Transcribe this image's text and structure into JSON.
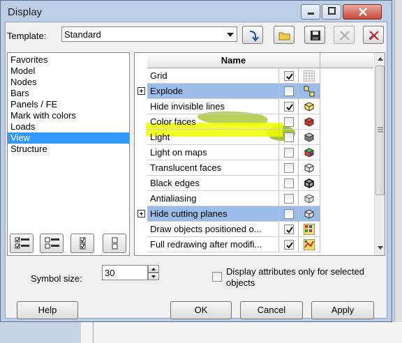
{
  "window": {
    "title": "Display"
  },
  "template": {
    "label": "Template:",
    "value": "Standard"
  },
  "toolbar_icons": [
    "apply-arrow-icon",
    "open-folder-icon",
    "save-icon",
    "delete-icon",
    "reset-icon"
  ],
  "categories": [
    "Favorites",
    "Model",
    "Nodes",
    "Bars",
    "Panels / FE",
    "Mark with colors",
    "Loads",
    "View",
    "Structure"
  ],
  "selected_category": "View",
  "grid": {
    "header": "Name",
    "rows": [
      {
        "name": "Grid",
        "checked": true,
        "group": false,
        "icon": "grid-icon"
      },
      {
        "name": "Explode",
        "checked": false,
        "group": true,
        "icon": "explode-icon"
      },
      {
        "name": "Hide invisible lines",
        "checked": true,
        "group": false,
        "icon": "hide-lines-icon"
      },
      {
        "name": "Color faces",
        "checked": false,
        "group": false,
        "icon": "color-faces-icon"
      },
      {
        "name": "Light",
        "checked": false,
        "group": false,
        "icon": "light-icon"
      },
      {
        "name": "Light on maps",
        "checked": false,
        "group": false,
        "icon": "light-maps-icon"
      },
      {
        "name": "Translucent faces",
        "checked": false,
        "group": false,
        "icon": "translucent-icon"
      },
      {
        "name": "Black edges",
        "checked": false,
        "group": false,
        "icon": "black-edges-icon"
      },
      {
        "name": "Antialiasing",
        "checked": false,
        "group": false,
        "icon": "antialiasing-icon"
      },
      {
        "name": "Hide cutting planes",
        "checked": false,
        "group": true,
        "icon": "cutting-planes-icon"
      },
      {
        "name": "Draw objects positioned o...",
        "checked": true,
        "group": false,
        "icon": "draw-objects-icon"
      },
      {
        "name": "Full redrawing after modifi...",
        "checked": true,
        "group": false,
        "icon": "redraw-icon"
      }
    ]
  },
  "symbol_size": {
    "label": "Symbol size:",
    "value": "30"
  },
  "attributes": {
    "label_line1": "Display attributes only for selected",
    "label_line2": "objects",
    "checked": false
  },
  "buttons": {
    "help": "Help",
    "ok": "OK",
    "cancel": "Cancel",
    "apply": "Apply"
  },
  "colors": {
    "group_row": "#9bbbe8",
    "selection": "#3399ff",
    "highlight": "#f0ff00"
  }
}
